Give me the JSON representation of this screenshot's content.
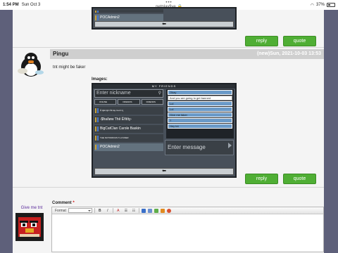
{
  "status_bar": {
    "time": "1:54 PM",
    "date": "Sun Oct 3",
    "url": "netplayfive",
    "battery": "37%"
  },
  "prev_post": {
    "friends": [
      {
        "name": "POCAdmin2",
        "selected": true
      }
    ],
    "buttons": {
      "reply": "reply",
      "quote": "quote"
    }
  },
  "post": {
    "author": "Pingu",
    "date": "(new)Sun, 2021-10-03 13:53",
    "body": "tnt might be faker",
    "images_label": "Images:",
    "screenshot": {
      "title": "MY FRIENDS",
      "search_placeholder": "Enter nickname",
      "tabs": [
        "ONLINE",
        "FRIENDS",
        "FRIENDS"
      ],
      "friends": [
        {
          "name": "Ꮆ ꭆƙΔ ꭆΩ Ƈʀʏʀɏ ɪɪʟʟɪɪɪ ꭆ",
          "selected": false,
          "small": true
        },
        {
          "name": "-$ħaðøw Thê Ëñtïty-",
          "selected": false,
          "small": false
        },
        {
          "name": "BigCatClan Carole Baskin",
          "selected": false,
          "small": false
        },
        {
          "name": "THE NOTORIOUS T-LCVDER",
          "selected": false,
          "small": true
        },
        {
          "name": "POCAdmin2",
          "selected": true,
          "small": false
        }
      ],
      "messages": [
        {
          "text": "Okay",
          "highlight": false
        },
        {
          "text": "And you are going to get banned",
          "highlight": true
        },
        {
          "text": "Lol",
          "highlight": false
        },
        {
          "text": "Lol",
          "highlight": false
        },
        {
          "text": "Give me faker",
          "highlight": false
        },
        {
          "text": "?",
          "highlight": false
        },
        {
          "text": "Hey tnt",
          "highlight": false
        }
      ],
      "input_placeholder": "Enter message",
      "back_symbol": "⮐"
    },
    "buttons": {
      "reply": "reply",
      "quote": "quote"
    }
  },
  "comment_form": {
    "user_name": "Give me tnt",
    "label": "Comment",
    "required_mark": "*",
    "toolbar": {
      "format_label": "Format",
      "bold": "B",
      "italic": "I",
      "font_color": "A"
    }
  }
}
